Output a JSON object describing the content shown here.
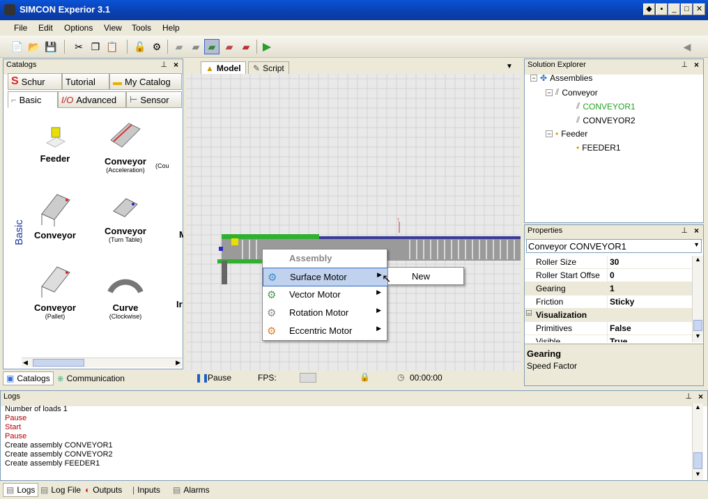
{
  "window": {
    "title": "SIMCON Experior 3.1"
  },
  "menu": [
    "File",
    "Edit",
    "Options",
    "View",
    "Tools",
    "Help"
  ],
  "catalogs": {
    "title": "Catalogs",
    "tabs": [
      "Schur",
      "Tutorial",
      "My Catalog",
      "Basic",
      "Advanced",
      "Sensor"
    ],
    "side_label": "Basic",
    "items": [
      {
        "name": "Feeder",
        "sub": ""
      },
      {
        "name": "Conveyor",
        "sub": "(Acceleration)"
      },
      {
        "name": "",
        "sub": "(Cou"
      },
      {
        "name": "Conveyor",
        "sub": ""
      },
      {
        "name": "Conveyor",
        "sub": "(Turn Table)"
      },
      {
        "name": "M",
        "sub": ""
      },
      {
        "name": "Conveyor",
        "sub": "(Pallet)"
      },
      {
        "name": "Curve",
        "sub": "(Clockwise)"
      },
      {
        "name": "Ir",
        "sub": ""
      }
    ]
  },
  "left_bottom_tabs": [
    "Catalogs",
    "Communication"
  ],
  "view_tabs": [
    "Model",
    "Script"
  ],
  "context_menu": {
    "header": "Assembly",
    "items": [
      "Surface Motor",
      "Vector Motor",
      "Rotation Motor",
      "Eccentric Motor"
    ],
    "submenu": [
      "New"
    ]
  },
  "status": {
    "pause": "Pause",
    "fps_label": "FPS:",
    "time": "00:00:00"
  },
  "solution_explorer": {
    "title": "Solution Explorer",
    "root": "Assemblies",
    "nodes": [
      "Conveyor",
      "CONVEYOR1",
      "CONVEYOR2",
      "Feeder",
      "FEEDER1"
    ]
  },
  "properties": {
    "title": "Properties",
    "selected": "Conveyor CONVEYOR1",
    "rows": [
      {
        "k": "Roller Size",
        "v": "30"
      },
      {
        "k": "Roller Start Offse",
        "v": "0"
      },
      {
        "k": "Gearing",
        "v": "1"
      },
      {
        "k": "Friction",
        "v": "Sticky"
      }
    ],
    "section": "Visualization",
    "rows2": [
      {
        "k": "Primitives",
        "v": "False"
      },
      {
        "k": "Visible",
        "v": "True"
      }
    ],
    "desc_title": "Gearing",
    "desc_text": "Speed Factor"
  },
  "logs": {
    "title": "Logs",
    "lines": [
      {
        "t": "Number of loads 1",
        "c": "#000000"
      },
      {
        "t": "Pause",
        "c": "#b00000"
      },
      {
        "t": "Start",
        "c": "#b00000"
      },
      {
        "t": "Pause",
        "c": "#b00000"
      },
      {
        "t": "Create assembly CONVEYOR1",
        "c": "#000000"
      },
      {
        "t": "Create assembly CONVEYOR2",
        "c": "#000000"
      },
      {
        "t": "Create assembly FEEDER1",
        "c": "#000000"
      }
    ]
  },
  "bottom_tabs": [
    "Logs",
    "Log File",
    "Outputs",
    "Inputs",
    "Alarms"
  ],
  "colors": {
    "selected_node": "#1fa31f",
    "accent": "#316ac5"
  }
}
